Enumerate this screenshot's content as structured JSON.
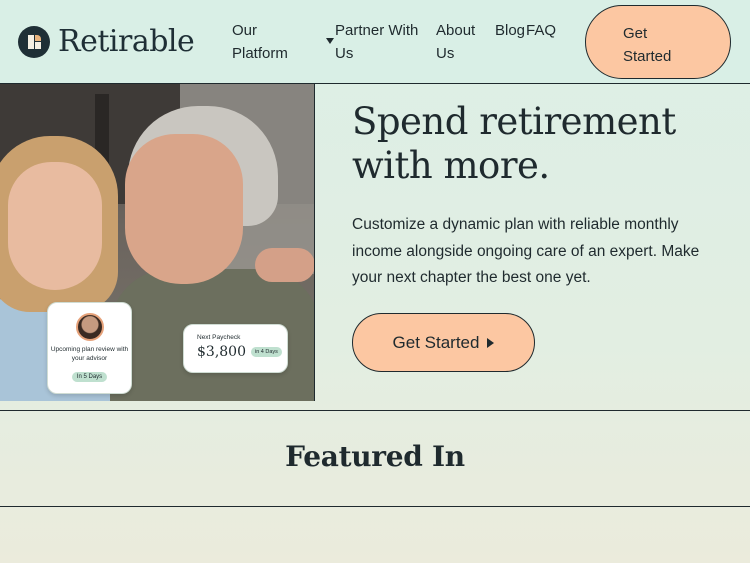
{
  "brand": {
    "name": "Retirable"
  },
  "nav": {
    "our_platform": "Our Platform",
    "partner_with_us": "Partner With Us",
    "about_us": "About Us",
    "blog": "Blog",
    "faq": "FAQ",
    "cta": "Get Started"
  },
  "hero": {
    "title": "Spend retirement with more.",
    "subtitle": "Customize a dynamic plan with reliable monthly income alongside ongoing care of an expert. Make your next chapter the best one yet.",
    "cta": "Get Started",
    "card_review": {
      "text": "Upcoming plan review with your advisor",
      "badge": "In 5 Days"
    },
    "card_paycheck": {
      "label": "Next Paycheck",
      "amount": "$3,800",
      "badge": "in 4 Days"
    }
  },
  "featured": {
    "title": "Featured In"
  },
  "colors": {
    "accent": "#fcc7a2",
    "nav_bg": "#d9efe6",
    "text": "#1f2a2e",
    "badge": "#bfe0cf"
  }
}
